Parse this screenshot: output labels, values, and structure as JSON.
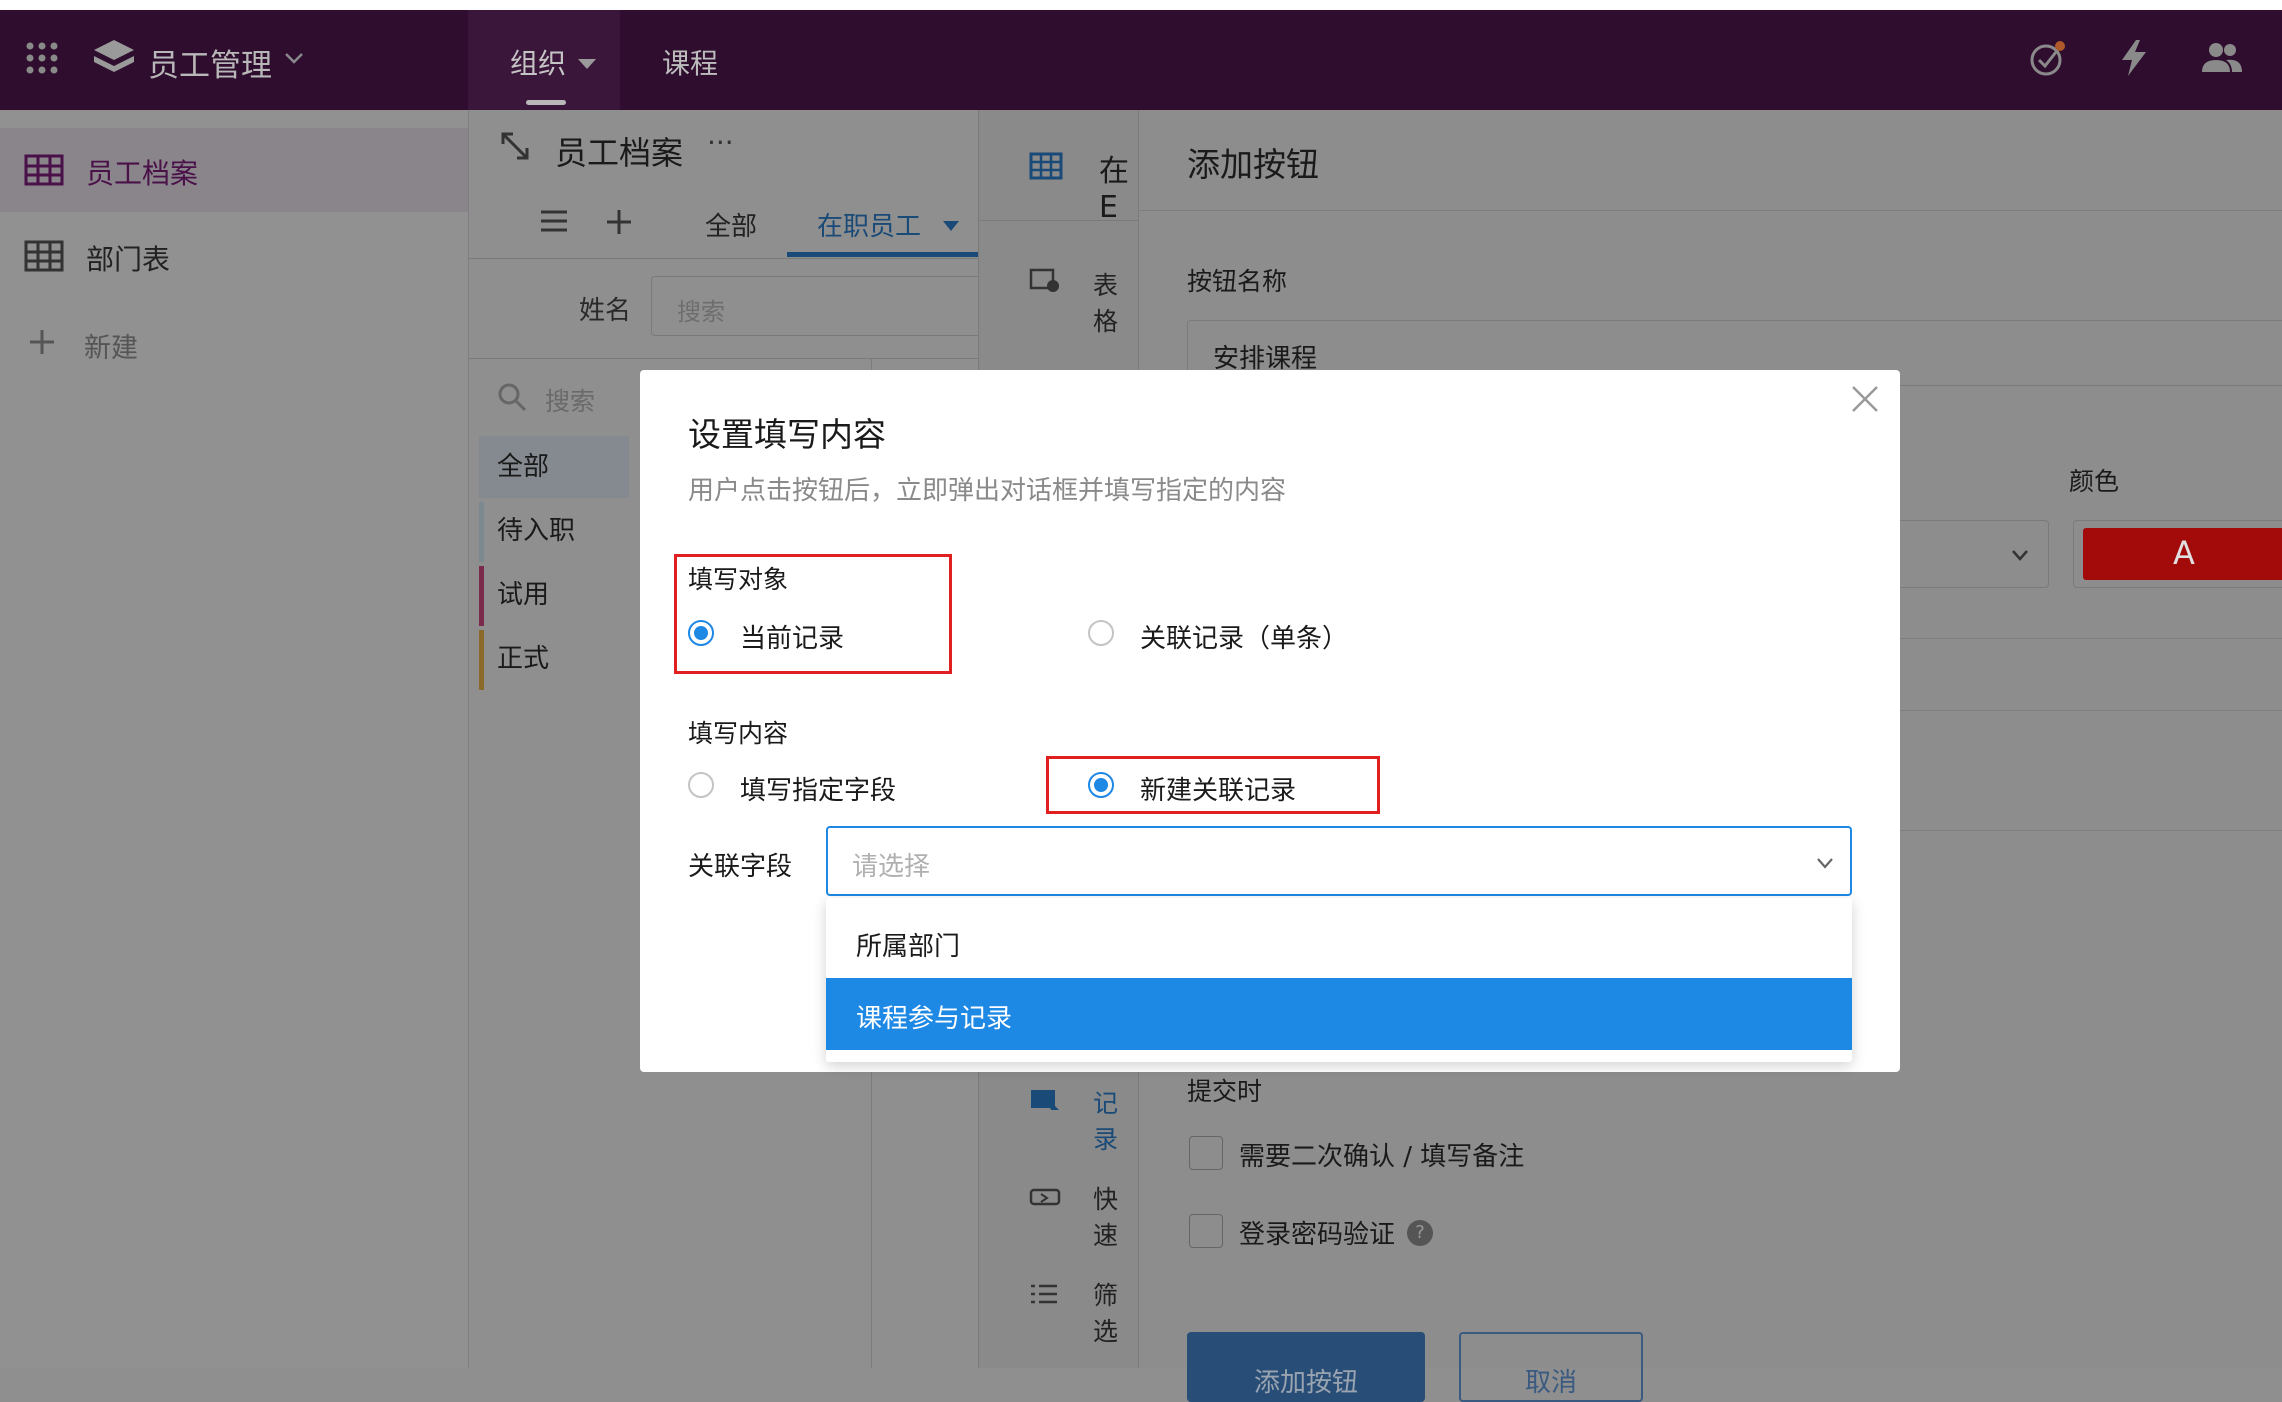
{
  "app": {
    "name": "员工管理",
    "nav_tabs": [
      {
        "label": "组织"
      },
      {
        "label": "课程"
      }
    ]
  },
  "sidebar": {
    "items": [
      {
        "label": "员工档案"
      },
      {
        "label": "部门表"
      }
    ],
    "new_label": "新建"
  },
  "middle": {
    "title": "员工档案",
    "more": "···",
    "view_tabs": [
      {
        "label": "全部"
      },
      {
        "label": "在职员工"
      }
    ],
    "filter_label": "姓名",
    "filter_placeholder": "搜索",
    "group_search_placeholder": "搜索",
    "groups": [
      {
        "label": "全部"
      },
      {
        "label": "待入职"
      },
      {
        "label": "试用"
      },
      {
        "label": "正式"
      }
    ]
  },
  "panel3": {
    "title_partial": "在E",
    "items": [
      {
        "label": "表格"
      },
      {
        "label": "记录"
      },
      {
        "label": "快速"
      },
      {
        "label": "筛选"
      }
    ]
  },
  "button_panel": {
    "title": "添加按钮",
    "name_label": "按钮名称",
    "name_value": "安排课程",
    "color_label": "颜色",
    "color_value": "A",
    "submit_section": "提交时",
    "check1": "需要二次确认 / 填写备注",
    "check2": "登录密码验证",
    "help": "?",
    "add_button": "添加按钮",
    "cancel_button": "取消"
  },
  "modal": {
    "title": "设置填写内容",
    "subtitle": "用户点击按钮后，立即弹出对话框并填写指定的内容",
    "target_label": "填写对象",
    "target_options": [
      {
        "label": "当前记录",
        "selected": true
      },
      {
        "label": "关联记录（单条）",
        "selected": false
      }
    ],
    "content_label": "填写内容",
    "content_options": [
      {
        "label": "填写指定字段",
        "selected": false
      },
      {
        "label": "新建关联记录",
        "selected": true
      }
    ],
    "field_label": "关联字段",
    "field_placeholder": "请选择",
    "dropdown_options": [
      {
        "label": "所属部门",
        "highlighted": false
      },
      {
        "label": "课程参与记录",
        "highlighted": true
      }
    ]
  },
  "colors": {
    "brand": "#4a1149",
    "accent": "#1e88e5",
    "highlight_box": "#e02020",
    "color_swatch": "#a30a0a"
  }
}
